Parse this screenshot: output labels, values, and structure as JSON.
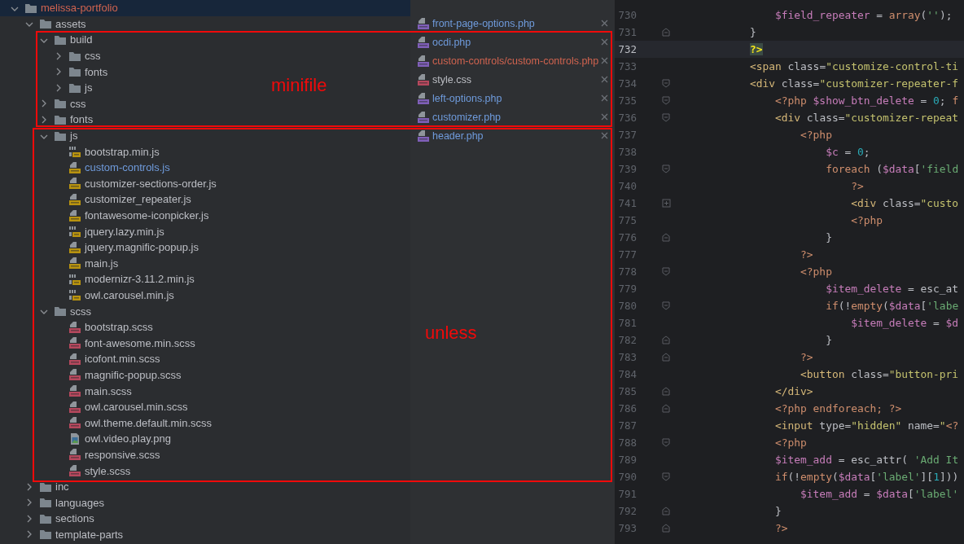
{
  "project_tree": {
    "items": [
      {
        "name": "melissa-portfolio",
        "kind": "folder",
        "color": "#d0634f",
        "selected": true,
        "expanded": true,
        "children": [
          {
            "name": "assets",
            "kind": "folder",
            "color": "#bcbec4",
            "selected": false,
            "expanded": true,
            "children": [
              {
                "name": "build",
                "kind": "folder",
                "color": "#bcbec4",
                "selected": false,
                "expanded": true,
                "children": [
                  {
                    "name": "css",
                    "kind": "folder",
                    "color": "#bcbec4",
                    "selected": false,
                    "expanded": false
                  },
                  {
                    "name": "fonts",
                    "kind": "folder",
                    "color": "#bcbec4",
                    "selected": false,
                    "expanded": false
                  },
                  {
                    "name": "js",
                    "kind": "folder",
                    "color": "#bcbec4",
                    "selected": false,
                    "expanded": false
                  }
                ]
              },
              {
                "name": "css",
                "kind": "folder",
                "color": "#bcbec4",
                "selected": false,
                "expanded": false
              },
              {
                "name": "fonts",
                "kind": "folder",
                "color": "#bcbec4",
                "selected": false,
                "expanded": false
              },
              {
                "name": "js",
                "kind": "folder",
                "color": "#bcbec4",
                "selected": false,
                "expanded": true,
                "children": [
                  {
                    "name": "bootstrap.min.js",
                    "kind": "minjs",
                    "color": "#bcbec4",
                    "selected": false
                  },
                  {
                    "name": "custom-controls.js",
                    "kind": "js",
                    "color": "#6f9bdc",
                    "selected": false
                  },
                  {
                    "name": "customizer-sections-order.js",
                    "kind": "js",
                    "color": "#bcbec4",
                    "selected": false
                  },
                  {
                    "name": "customizer_repeater.js",
                    "kind": "js",
                    "color": "#bcbec4",
                    "selected": false
                  },
                  {
                    "name": "fontawesome-iconpicker.js",
                    "kind": "js",
                    "color": "#bcbec4",
                    "selected": false
                  },
                  {
                    "name": "jquery.lazy.min.js",
                    "kind": "minjs",
                    "color": "#bcbec4",
                    "selected": false
                  },
                  {
                    "name": "jquery.magnific-popup.js",
                    "kind": "js",
                    "color": "#bcbec4",
                    "selected": false
                  },
                  {
                    "name": "main.js",
                    "kind": "js",
                    "color": "#bcbec4",
                    "selected": false
                  },
                  {
                    "name": "modernizr-3.11.2.min.js",
                    "kind": "minjs",
                    "color": "#bcbec4",
                    "selected": false
                  },
                  {
                    "name": "owl.carousel.min.js",
                    "kind": "minjs",
                    "color": "#bcbec4",
                    "selected": false
                  }
                ]
              },
              {
                "name": "scss",
                "kind": "folder",
                "color": "#bcbec4",
                "selected": false,
                "expanded": true,
                "children": [
                  {
                    "name": "bootstrap.scss",
                    "kind": "sass",
                    "color": "#bcbec4",
                    "selected": false
                  },
                  {
                    "name": "font-awesome.min.scss",
                    "kind": "sass",
                    "color": "#bcbec4",
                    "selected": false
                  },
                  {
                    "name": "icofont.min.scss",
                    "kind": "sass",
                    "color": "#bcbec4",
                    "selected": false
                  },
                  {
                    "name": "magnific-popup.scss",
                    "kind": "sass",
                    "color": "#bcbec4",
                    "selected": false
                  },
                  {
                    "name": "main.scss",
                    "kind": "sass",
                    "color": "#bcbec4",
                    "selected": false
                  },
                  {
                    "name": "owl.carousel.min.scss",
                    "kind": "sass",
                    "color": "#bcbec4",
                    "selected": false
                  },
                  {
                    "name": "owl.theme.default.min.scss",
                    "kind": "sass",
                    "color": "#bcbec4",
                    "selected": false
                  },
                  {
                    "name": "owl.video.play.png",
                    "kind": "png",
                    "color": "#bcbec4",
                    "selected": false
                  },
                  {
                    "name": "responsive.scss",
                    "kind": "sass",
                    "color": "#bcbec4",
                    "selected": false
                  },
                  {
                    "name": "style.scss",
                    "kind": "sass",
                    "color": "#bcbec4",
                    "selected": false
                  }
                ]
              }
            ]
          },
          {
            "name": "inc",
            "kind": "folder",
            "color": "#bcbec4",
            "selected": false,
            "expanded": false
          },
          {
            "name": "languages",
            "kind": "folder",
            "color": "#bcbec4",
            "selected": false,
            "expanded": false
          },
          {
            "name": "sections",
            "kind": "folder",
            "color": "#bcbec4",
            "selected": false,
            "expanded": false
          },
          {
            "name": "template-parts",
            "kind": "folder",
            "color": "#bcbec4",
            "selected": false,
            "expanded": false
          }
        ]
      }
    ]
  },
  "open_files": [
    {
      "name": "front-page-options.php",
      "kind": "php",
      "color": "#6f9bdc"
    },
    {
      "name": "ocdi.php",
      "kind": "php",
      "color": "#6f9bdc"
    },
    {
      "name": "custom-controls/custom-controls.php",
      "kind": "php",
      "color": "#d0634f"
    },
    {
      "name": "style.css",
      "kind": "css",
      "color": "#bcbec4"
    },
    {
      "name": "left-options.php",
      "kind": "php",
      "color": "#6f9bdc"
    },
    {
      "name": "customizer.php",
      "kind": "php",
      "color": "#6f9bdc"
    },
    {
      "name": "header.php",
      "kind": "php",
      "color": "#6f9bdc"
    }
  ],
  "editor": {
    "lines": [
      {
        "number": "730",
        "kind": "plain",
        "current": false,
        "tokens": [
          {
            "kind": "var",
            "text": "    $field_repeater"
          },
          {
            "kind": "plain",
            "text": " = "
          },
          {
            "kind": "kw",
            "text": "array"
          },
          {
            "kind": "plain",
            "text": "("
          },
          {
            "kind": "str",
            "text": "''"
          },
          {
            "kind": "plain",
            "text": ");"
          }
        ]
      },
      {
        "number": "731",
        "kind": "fold-end",
        "current": false,
        "tokens": [
          {
            "kind": "plain",
            "text": "}"
          }
        ]
      },
      {
        "number": "732",
        "kind": "plain",
        "current": true,
        "tokens": [
          {
            "kind": "mark",
            "text": "?>"
          }
        ]
      },
      {
        "number": "733",
        "kind": "plain",
        "current": false,
        "tokens": [
          {
            "kind": "tag",
            "text": "<span"
          },
          {
            "kind": "attr",
            "text": " class="
          },
          {
            "kind": "val",
            "text": "\"customize-control-ti"
          }
        ]
      },
      {
        "number": "734",
        "kind": "fold-start",
        "current": false,
        "tokens": [
          {
            "kind": "tag",
            "text": "<div"
          },
          {
            "kind": "attr",
            "text": " class="
          },
          {
            "kind": "val",
            "text": "\"customizer-repeater-f"
          }
        ]
      },
      {
        "number": "735",
        "kind": "fold-start",
        "current": false,
        "tokens": [
          {
            "kind": "kw",
            "text": "    <?php "
          },
          {
            "kind": "var",
            "text": "$show_btn_delete"
          },
          {
            "kind": "plain",
            "text": " = "
          },
          {
            "kind": "num",
            "text": "0"
          },
          {
            "kind": "plain",
            "text": "; "
          },
          {
            "kind": "kw",
            "text": "f"
          }
        ]
      },
      {
        "number": "736",
        "kind": "fold-start",
        "current": false,
        "tokens": [
          {
            "kind": "tag",
            "text": "    <div"
          },
          {
            "kind": "attr",
            "text": " class="
          },
          {
            "kind": "val",
            "text": "\"customizer-repeat"
          }
        ]
      },
      {
        "number": "737",
        "kind": "plain",
        "current": false,
        "tokens": [
          {
            "kind": "kw",
            "text": "        <?php"
          }
        ]
      },
      {
        "number": "738",
        "kind": "plain",
        "current": false,
        "tokens": [
          {
            "kind": "var",
            "text": "            $c"
          },
          {
            "kind": "plain",
            "text": " = "
          },
          {
            "kind": "num",
            "text": "0"
          },
          {
            "kind": "plain",
            "text": ";"
          }
        ]
      },
      {
        "number": "739",
        "kind": "fold-start",
        "current": false,
        "tokens": [
          {
            "kind": "kw",
            "text": "            foreach"
          },
          {
            "kind": "plain",
            "text": " ("
          },
          {
            "kind": "var",
            "text": "$data"
          },
          {
            "kind": "plain",
            "text": "["
          },
          {
            "kind": "str",
            "text": "'field"
          }
        ]
      },
      {
        "number": "740",
        "kind": "plain",
        "current": false,
        "tokens": [
          {
            "kind": "kw",
            "text": "                ?>"
          }
        ]
      },
      {
        "number": "741",
        "kind": "collapsed",
        "current": false,
        "tokens": [
          {
            "kind": "tag",
            "text": "                <div"
          },
          {
            "kind": "attr",
            "text": " class="
          },
          {
            "kind": "val",
            "text": "\"custo"
          }
        ]
      },
      {
        "number": "775",
        "kind": "plain",
        "current": false,
        "tokens": [
          {
            "kind": "kw",
            "text": "                <?php"
          }
        ]
      },
      {
        "number": "776",
        "kind": "fold-end",
        "current": false,
        "tokens": [
          {
            "kind": "plain",
            "text": "            }"
          }
        ]
      },
      {
        "number": "777",
        "kind": "plain",
        "current": false,
        "tokens": [
          {
            "kind": "kw",
            "text": "        ?>"
          }
        ]
      },
      {
        "number": "778",
        "kind": "fold-start",
        "current": false,
        "tokens": [
          {
            "kind": "kw",
            "text": "        <?php"
          }
        ]
      },
      {
        "number": "779",
        "kind": "plain",
        "current": false,
        "tokens": [
          {
            "kind": "var",
            "text": "            $item_delete"
          },
          {
            "kind": "plain",
            "text": " = esc_at"
          }
        ]
      },
      {
        "number": "780",
        "kind": "fold-start",
        "current": false,
        "tokens": [
          {
            "kind": "kw",
            "text": "            if"
          },
          {
            "kind": "plain",
            "text": "(!"
          },
          {
            "kind": "kw",
            "text": "empty"
          },
          {
            "kind": "plain",
            "text": "("
          },
          {
            "kind": "var",
            "text": "$data"
          },
          {
            "kind": "plain",
            "text": "["
          },
          {
            "kind": "str",
            "text": "'labe"
          }
        ]
      },
      {
        "number": "781",
        "kind": "plain",
        "current": false,
        "tokens": [
          {
            "kind": "var",
            "text": "                $item_delete"
          },
          {
            "kind": "plain",
            "text": " = "
          },
          {
            "kind": "var",
            "text": "$d"
          }
        ]
      },
      {
        "number": "782",
        "kind": "fold-end",
        "current": false,
        "tokens": [
          {
            "kind": "plain",
            "text": "            }"
          }
        ]
      },
      {
        "number": "783",
        "kind": "fold-end",
        "current": false,
        "tokens": [
          {
            "kind": "kw",
            "text": "        ?>"
          }
        ]
      },
      {
        "number": "784",
        "kind": "plain",
        "current": false,
        "tokens": [
          {
            "kind": "tag",
            "text": "        <button"
          },
          {
            "kind": "attr",
            "text": " class="
          },
          {
            "kind": "val",
            "text": "\"button-pri"
          }
        ]
      },
      {
        "number": "785",
        "kind": "fold-end",
        "current": false,
        "tokens": [
          {
            "kind": "tag",
            "text": "    </div>"
          }
        ]
      },
      {
        "number": "786",
        "kind": "fold-end",
        "current": false,
        "tokens": [
          {
            "kind": "kw",
            "text": "    <?php endforeach; ?>"
          }
        ]
      },
      {
        "number": "787",
        "kind": "plain",
        "current": false,
        "tokens": [
          {
            "kind": "tag",
            "text": "    <input"
          },
          {
            "kind": "attr",
            "text": " type="
          },
          {
            "kind": "val",
            "text": "\"hidden\""
          },
          {
            "kind": "attr",
            "text": " name="
          },
          {
            "kind": "val",
            "text": "\""
          },
          {
            "kind": "kw",
            "text": "<?"
          }
        ]
      },
      {
        "number": "788",
        "kind": "fold-start",
        "current": false,
        "tokens": [
          {
            "kind": "kw",
            "text": "    <?php"
          }
        ]
      },
      {
        "number": "789",
        "kind": "plain",
        "current": false,
        "tokens": [
          {
            "kind": "var",
            "text": "    $item_add"
          },
          {
            "kind": "plain",
            "text": " = esc_attr( "
          },
          {
            "kind": "str",
            "text": "'Add It"
          }
        ]
      },
      {
        "number": "790",
        "kind": "fold-start",
        "current": false,
        "tokens": [
          {
            "kind": "kw",
            "text": "    if"
          },
          {
            "kind": "plain",
            "text": "(!"
          },
          {
            "kind": "kw",
            "text": "empty"
          },
          {
            "kind": "plain",
            "text": "("
          },
          {
            "kind": "var",
            "text": "$data"
          },
          {
            "kind": "plain",
            "text": "["
          },
          {
            "kind": "str",
            "text": "'label'"
          },
          {
            "kind": "plain",
            "text": "]["
          },
          {
            "kind": "num",
            "text": "1"
          },
          {
            "kind": "plain",
            "text": "]))"
          }
        ]
      },
      {
        "number": "791",
        "kind": "plain",
        "current": false,
        "tokens": [
          {
            "kind": "var",
            "text": "        $item_add"
          },
          {
            "kind": "plain",
            "text": " = "
          },
          {
            "kind": "var",
            "text": "$data"
          },
          {
            "kind": "plain",
            "text": "["
          },
          {
            "kind": "str",
            "text": "'label'"
          }
        ]
      },
      {
        "number": "792",
        "kind": "fold-end",
        "current": false,
        "tokens": [
          {
            "kind": "plain",
            "text": "    }"
          }
        ]
      },
      {
        "number": "793",
        "kind": "fold-end",
        "current": false,
        "tokens": [
          {
            "kind": "kw",
            "text": "    ?>"
          }
        ]
      }
    ]
  },
  "annotations": [
    {
      "label": "minifile"
    },
    {
      "label": "unless"
    }
  ]
}
